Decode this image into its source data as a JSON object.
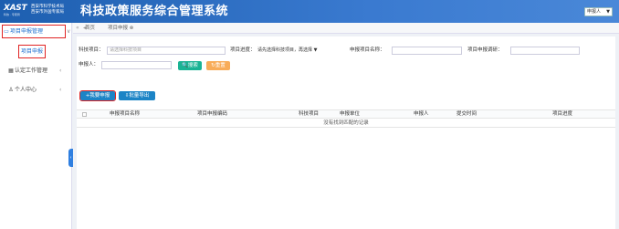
{
  "header": {
    "logo_text": "XAST",
    "logo_sub": "科协 · 专家局",
    "org_line1": "西安市科学技术局",
    "org_line2": "西安市外国专家局",
    "title": "科技政策服务综合管理系统",
    "user_label": "申报人",
    "user_caret": "▼"
  },
  "sidebar": {
    "items": [
      {
        "label": "项目申报管理",
        "icon": "▭",
        "chevron": "∨"
      },
      {
        "label": "项目申报",
        "icon": "",
        "chevron": ""
      },
      {
        "label": "认定工作管理",
        "icon": "▦",
        "chevron": "‹"
      },
      {
        "label": "个人中心",
        "icon": "♙",
        "chevron": "‹"
      }
    ],
    "toggle": "‹"
  },
  "tabs": {
    "back": "«",
    "prev": "◂",
    "home": "首页",
    "current": "项目申报",
    "current_close": "⊗"
  },
  "filters": {
    "project_label": "科技项目：",
    "project_placeholder": "请选择科技项目",
    "status_label": "项目进度：",
    "status_value": "请先选择科技项目，再选择",
    "status_caret": "▼",
    "name_label": "申报项目名称：",
    "unit_label": "项目申报调研：",
    "applicant_label": "申报人：",
    "search_label": "搜索",
    "reset_label": "重置",
    "search_icon": "🔍",
    "reset_icon": "↻"
  },
  "actions": {
    "apply_label": "我要申报",
    "apply_icon": "+",
    "export_label": "批量导出",
    "export_icon": "⇩"
  },
  "table": {
    "columns": [
      "申报项目名称",
      "项目申报编码",
      "科技项目",
      "申报单位",
      "申报人",
      "提交时间",
      "项目进度"
    ],
    "empty_text": "没有找到匹配的记录"
  }
}
